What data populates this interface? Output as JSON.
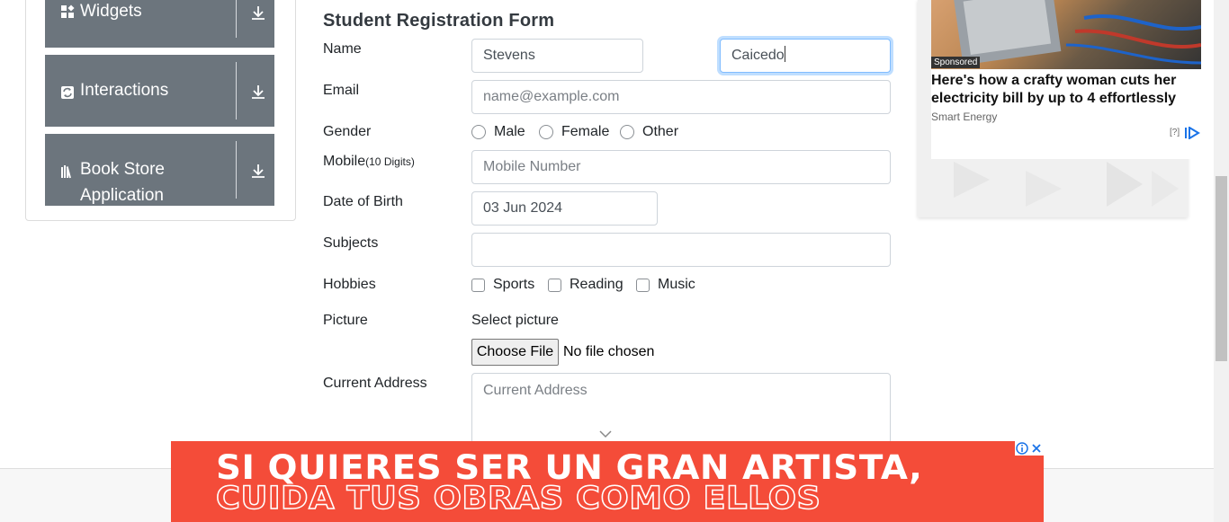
{
  "sidebar": {
    "groups": [
      {
        "label": "Widgets",
        "icon": "widgets-icon"
      },
      {
        "label": "Interactions",
        "icon": "interactions-icon"
      },
      {
        "label_line1": "Book Store",
        "label_line2": "Application",
        "icon": "book-store-icon"
      }
    ],
    "expand_icon": "download-arrow-icon"
  },
  "form": {
    "title": "Student Registration Form",
    "name_label": "Name",
    "first_name_value": "Stevens",
    "last_name_value": "Caicedo",
    "email_label": "Email",
    "email_placeholder": "name@example.com",
    "gender_label": "Gender",
    "gender_options": [
      "Male",
      "Female",
      "Other"
    ],
    "mobile_label": "Mobile",
    "mobile_hint": "(10 Digits)",
    "mobile_placeholder": "Mobile Number",
    "dob_label": "Date of Birth",
    "dob_value": "03 Jun 2024",
    "subjects_label": "Subjects",
    "hobbies_label": "Hobbies",
    "hobbies_options": [
      "Sports",
      "Reading",
      "Music"
    ],
    "picture_label": "Picture",
    "picture_prompt": "Select picture",
    "choose_file_label": "Choose File",
    "no_file_text": "No file chosen",
    "address_label": "Current Address",
    "address_placeholder": "Current Address"
  },
  "ad": {
    "sponsored": "Sponsored",
    "headline": "Here's how a crafty woman cuts her electricity bill by up to 4 effortlessly",
    "source": "Smart Energy",
    "help": "[?]"
  },
  "banner": {
    "line1": "SI QUIERES SER UN GRAN ARTISTA,",
    "line2": "CUIDA TUS OBRAS COMO ELLOS",
    "color": "#f44c39"
  },
  "colors": {
    "sidebar_group": "#6c757d",
    "focus_border": "#80bdff"
  }
}
